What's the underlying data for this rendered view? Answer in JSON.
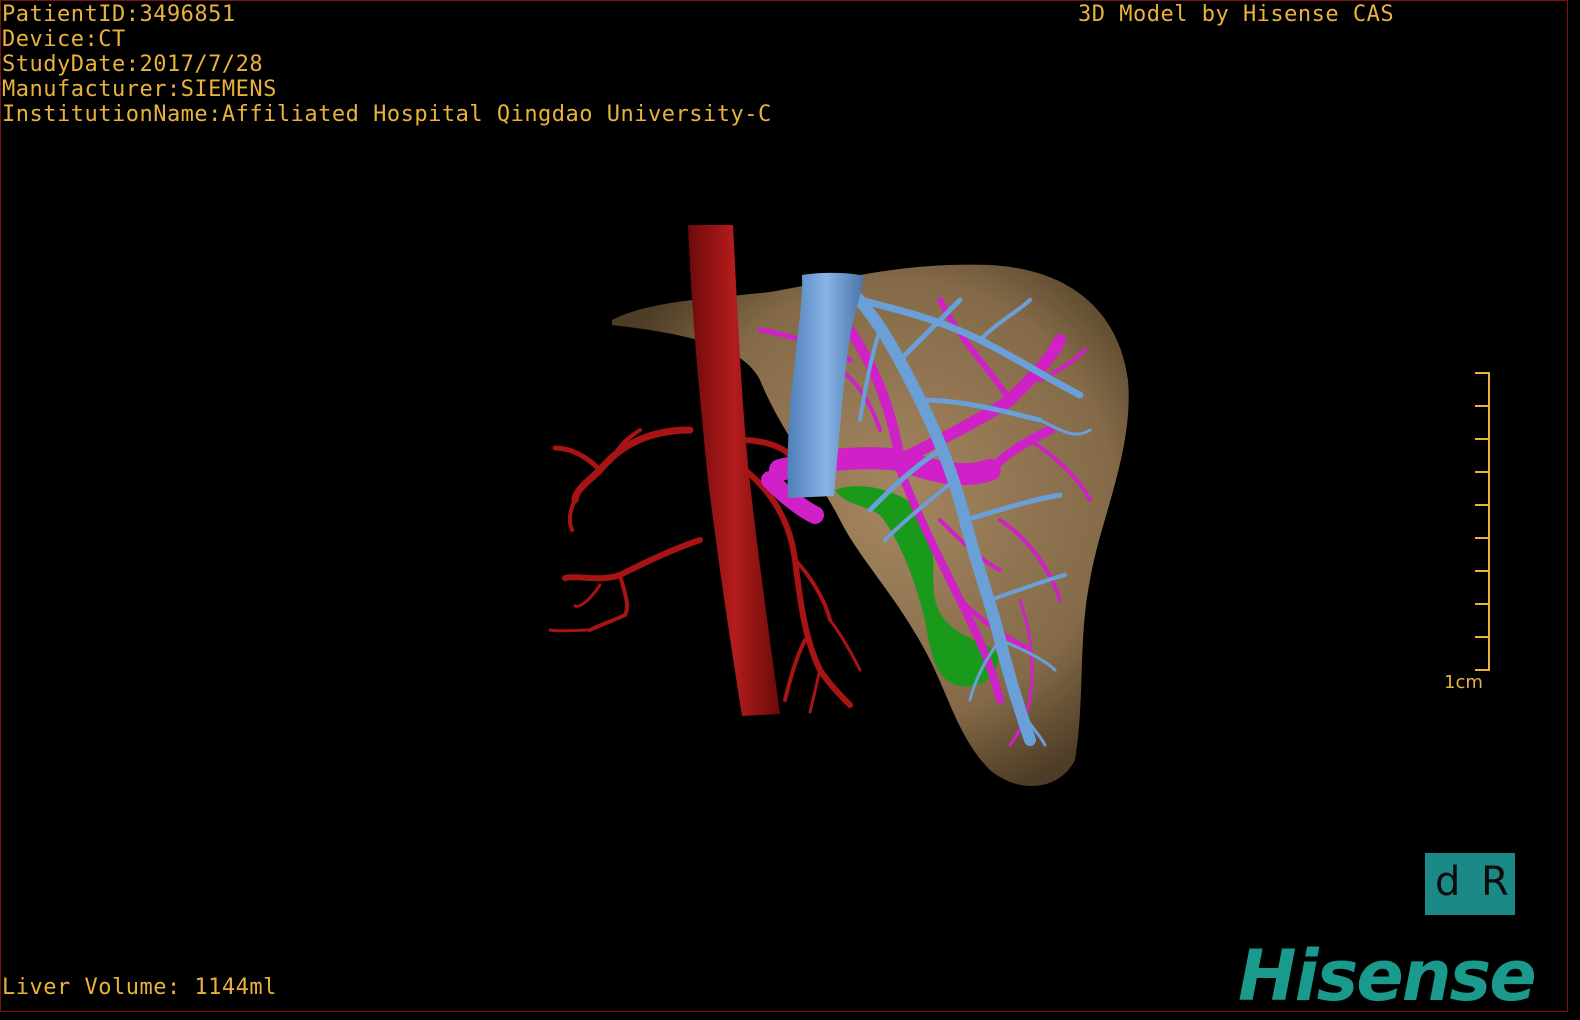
{
  "header": {
    "patient_id": "PatientID:3496851",
    "device": "Device:CT",
    "study_date": "StudyDate:2017/7/28",
    "manufacturer": "Manufacturer:SIEMENS",
    "institution": "InstitutionName:Affiliated Hospital Qingdao University-C"
  },
  "brand_caption": "3D Model by Hisense CAS",
  "footer": {
    "liver_volume": "Liver Volume: 1144ml"
  },
  "scale_bar": {
    "label": "1cm"
  },
  "orientation": {
    "left": "d",
    "right": "R"
  },
  "logo": "Hisense",
  "colors": {
    "overlay_text": "#e8b23c",
    "liver": "#8a7050",
    "artery": "#b01818",
    "vena_cava": "#6fa0d8",
    "portal_vein": "#d020c8",
    "gallbladder": "#1a9a1a",
    "brand": "#1a9a8c"
  }
}
